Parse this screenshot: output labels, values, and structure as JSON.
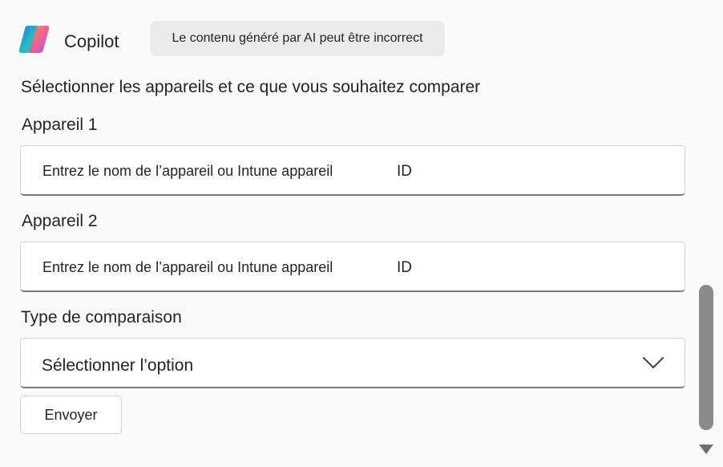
{
  "header": {
    "app_name": "Copilot",
    "disclaimer": "Le contenu généré par AI peut être incorrect",
    "logo_icon": "copilot-logo-icon"
  },
  "form": {
    "intro": "Sélectionner les appareils et ce que vous souhaitez comparer",
    "device1": {
      "label": "Appareil 1",
      "placeholder": "Entrez le nom de l’appareil ou Intune appareil",
      "placeholder_suffix": "ID"
    },
    "device2": {
      "label": "Appareil 2",
      "placeholder": "Entrez le nom de l’appareil ou Intune appareil",
      "placeholder_suffix": "ID"
    },
    "comparison": {
      "label": "Type de comparaison",
      "selected": "Sélectionner l’option",
      "icon": "chevron-down-icon"
    },
    "submit_label": "Envoyer"
  },
  "scrollbar": {
    "arrow_icon": "scroll-down-arrow-icon"
  },
  "colors": {
    "background": "#fafafa",
    "field_border": "#d1d1d1",
    "field_underline": "#7a7a7a",
    "disclaimer_bg": "#ebebeb",
    "scroll_thumb": "#8a8a8a"
  }
}
